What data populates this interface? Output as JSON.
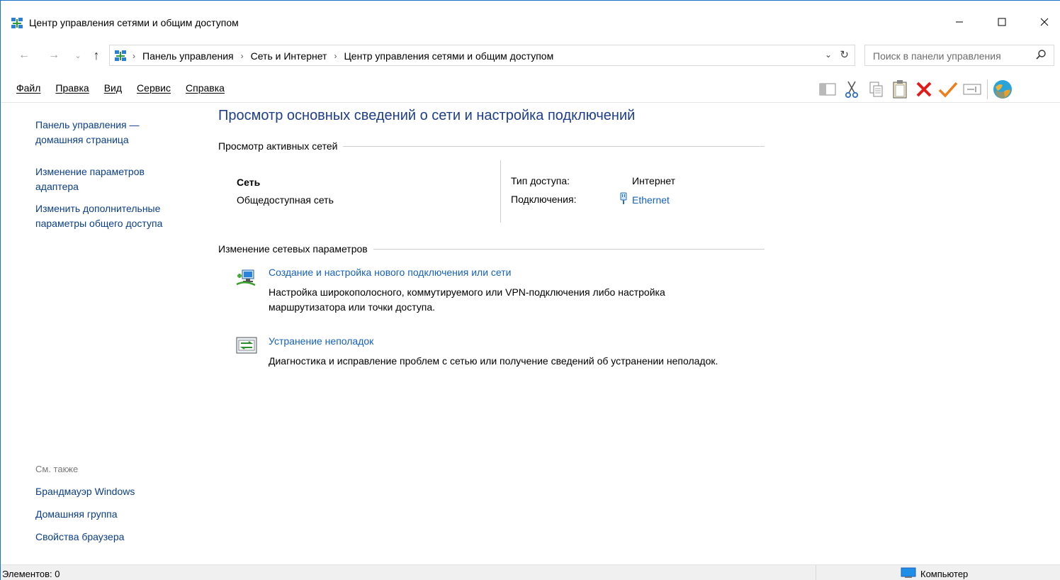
{
  "window": {
    "title": "Центр управления сетями и общим доступом",
    "minimize": "—",
    "maximize": "☐",
    "close": "✕"
  },
  "nav": {
    "back": "←",
    "forward": "→",
    "recent": "⌄",
    "up": "↑",
    "breadcrumbs": [
      "Панель управления",
      "Сеть и Интернет",
      "Центр управления сетями и общим доступом"
    ],
    "separator": "›",
    "dropdown": "⌄",
    "refresh": "↻"
  },
  "search": {
    "placeholder": "Поиск в панели управления"
  },
  "menu": {
    "items": [
      "Файл",
      "Правка",
      "Вид",
      "Сервис",
      "Справка"
    ]
  },
  "toolbar": {
    "icons": [
      "pane-icon",
      "cut-icon",
      "copy-icon",
      "paste-icon",
      "delete-icon",
      "properties-check-icon",
      "rename-icon",
      "globe-icon"
    ]
  },
  "sidebar": {
    "home_link": "Панель управления — домашняя страница",
    "links": [
      "Изменение параметров адаптера",
      "Изменить дополнительные параметры общего доступа"
    ],
    "see_also_label": "См. также",
    "see_also": [
      "Брандмауэр Windows",
      "Домашняя группа",
      "Свойства браузера"
    ]
  },
  "main": {
    "title": "Просмотр основных сведений о сети и настройка подключений",
    "active_networks_header": "Просмотр активных сетей",
    "network": {
      "name": "Сеть",
      "category": "Общедоступная сеть",
      "access_type_label": "Тип доступа:",
      "access_type_value": "Интернет",
      "connections_label": "Подключения:",
      "connection_value": "Ethernet"
    },
    "change_settings_header": "Изменение сетевых параметров",
    "tasks": [
      {
        "link": "Создание и настройка нового подключения или сети",
        "desc": "Настройка широкополосного, коммутируемого или VPN-подключения либо настройка маршрутизатора или точки доступа."
      },
      {
        "link": "Устранение неполадок",
        "desc": "Диагностика и исправление проблем с сетью или получение сведений об устранении неполадок."
      }
    ]
  },
  "status": {
    "items_count": "Элементов: 0",
    "zone": "Компьютер"
  },
  "colors": {
    "link": "#1560bd",
    "title": "#1e3e8c",
    "window_border": "#1a73c9",
    "statusbar": "#f0f0f0"
  }
}
